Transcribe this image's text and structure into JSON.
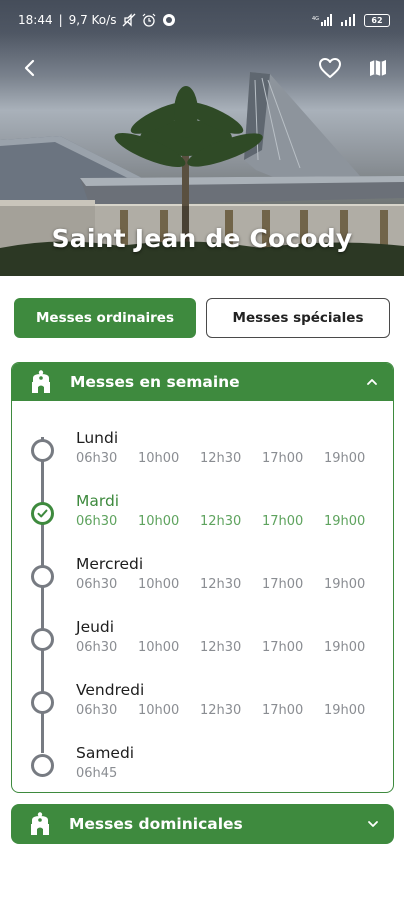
{
  "status": {
    "time": "18:44",
    "speed": "9,7 Ko/s",
    "battery": "62"
  },
  "header": {
    "title": "Saint Jean de Cocody",
    "back_icon": "back-arrow-icon",
    "favorite_icon": "heart-outline-icon",
    "map_icon": "map-icon"
  },
  "tabs": [
    {
      "label": "Messes ordinaires",
      "active": true
    },
    {
      "label": "Messes spéciales",
      "active": false
    }
  ],
  "sections": {
    "weekday": {
      "title": "Messes en semaine",
      "expanded": true,
      "icon": "church-bell-icon",
      "days": [
        {
          "name": "Lundi",
          "times": [
            "06h30",
            "10h00",
            "12h30",
            "17h00",
            "19h00"
          ],
          "active": false
        },
        {
          "name": "Mardi",
          "times": [
            "06h30",
            "10h00",
            "12h30",
            "17h00",
            "19h00"
          ],
          "active": true
        },
        {
          "name": "Mercredi",
          "times": [
            "06h30",
            "10h00",
            "12h30",
            "17h00",
            "19h00"
          ],
          "active": false
        },
        {
          "name": "Jeudi",
          "times": [
            "06h30",
            "10h00",
            "12h30",
            "17h00",
            "19h00"
          ],
          "active": false
        },
        {
          "name": "Vendredi",
          "times": [
            "06h30",
            "10h00",
            "12h30",
            "17h00",
            "19h00"
          ],
          "active": false
        },
        {
          "name": "Samedi",
          "times": [
            "06h45"
          ],
          "active": false
        }
      ]
    },
    "sunday": {
      "title": "Messes dominicales",
      "expanded": false,
      "icon": "church-bell-icon"
    }
  },
  "colors": {
    "brand_green": "#3e8a3e",
    "timeline_gray": "#777b82",
    "time_gray": "#8a8d92"
  }
}
